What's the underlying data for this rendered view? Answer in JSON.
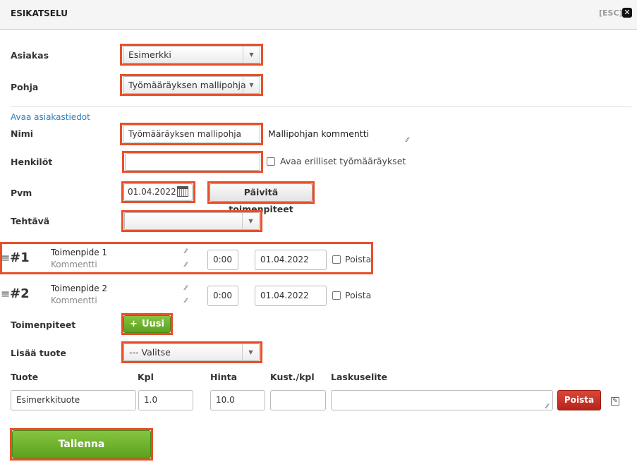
{
  "header": {
    "title": "ESIKATSELU",
    "esc_label": "[ESC]",
    "close_icon": "close-icon"
  },
  "form": {
    "asiakas": {
      "label": "Asiakas",
      "value": "Esimerkki"
    },
    "pohja": {
      "label": "Pohja",
      "value": "Työmääräyksen mallipohja"
    },
    "open_customer_link": "Avaa asiakastiedot",
    "nimi": {
      "label": "Nimi",
      "value": "Työmääräyksen mallipohja",
      "comment": "Mallipohjan kommentti"
    },
    "henkilot": {
      "label": "Henkilöt",
      "value": "",
      "checkbox_label": "Avaa erilliset työmääräykset"
    },
    "pvm": {
      "label": "Pvm",
      "value": "01.04.2022",
      "update_button": "Päivitä toimenpiteet"
    },
    "tehtava": {
      "label": "Tehtävä",
      "value": ""
    }
  },
  "actions": [
    {
      "number": "#1",
      "name": "Toimenpide 1",
      "comment_placeholder": "Kommentti",
      "time": "0:00",
      "date": "01.04.2022",
      "delete_label": "Poista"
    },
    {
      "number": "#2",
      "name": "Toimenpide 2",
      "comment_placeholder": "Kommentti",
      "time": "0:00",
      "date": "01.04.2022",
      "delete_label": "Poista"
    }
  ],
  "toimenpiteet": {
    "label": "Toimenpiteet",
    "new_button": "Uusi",
    "new_icon": "+"
  },
  "lisaa_tuote": {
    "label": "Lisää tuote",
    "value": "--- Valitse"
  },
  "products": {
    "headers": [
      "Tuote",
      "Kpl",
      "Hinta",
      "Kust./kpl",
      "Laskuselite"
    ],
    "rows": [
      {
        "tuote": "Esimerkkituote",
        "kpl": "1.0",
        "hinta": "10.0",
        "kust": "",
        "laskuselite": "",
        "delete_label": "Poista"
      }
    ]
  },
  "save_button": "Tallenna",
  "colors": {
    "highlight": "#e8502a",
    "green": "#5aa21f",
    "red": "#b82318",
    "link": "#2c7fc0"
  }
}
